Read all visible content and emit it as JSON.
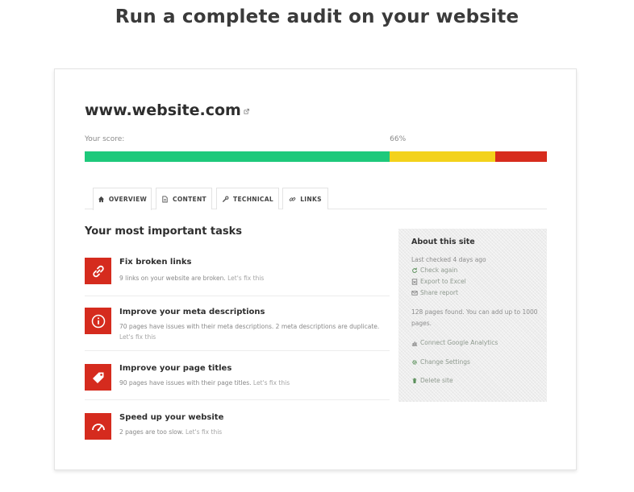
{
  "headline": "Run a complete audit on your website",
  "site": {
    "url": "www.website.com"
  },
  "score": {
    "label": "Your score:",
    "value_text": "66%",
    "value": 0.66,
    "segments": {
      "green": 0.66,
      "yellow": 0.228,
      "red": 0.112
    },
    "colors": {
      "green": "#1ec97b",
      "yellow": "#f3d21b",
      "red": "#d72c1d"
    }
  },
  "tabs": [
    {
      "label": "OVERVIEW",
      "icon": "home-icon",
      "active": true
    },
    {
      "label": "CONTENT",
      "icon": "document-icon",
      "active": false
    },
    {
      "label": "TECHNICAL",
      "icon": "wrench-icon",
      "active": false
    },
    {
      "label": "LINKS",
      "icon": "link-icon",
      "active": false
    }
  ],
  "tasks_section": {
    "title": "Your most important tasks",
    "accent": "#d52b1e",
    "items": [
      {
        "title": "Fix broken links",
        "desc": "9 links on your website are broken.",
        "fix": "Let's fix this",
        "icon": "broken-link-icon"
      },
      {
        "title": "Improve your meta descriptions",
        "desc": "70 pages have issues with their meta descriptions. 2 meta descriptions are duplicate.",
        "fix": "Let's fix this",
        "icon": "info-icon"
      },
      {
        "title": "Improve your page titles",
        "desc": "90 pages have issues with their page titles.",
        "fix": "Let's fix this",
        "icon": "tag-icon"
      },
      {
        "title": "Speed up your website",
        "desc": "2 pages are too slow.",
        "fix": "Let's fix this",
        "icon": "speedometer-icon"
      }
    ]
  },
  "about": {
    "title": "About this site",
    "last_checked": "Last checked 4 days ago",
    "check_again": "Check again",
    "export": "Export to Excel",
    "share": "Share report",
    "pages_found": "128 pages found. You can add up to 1000 pages.",
    "analytics": "Connect Google Analytics",
    "settings": "Change Settings",
    "delete": "Delete site"
  }
}
